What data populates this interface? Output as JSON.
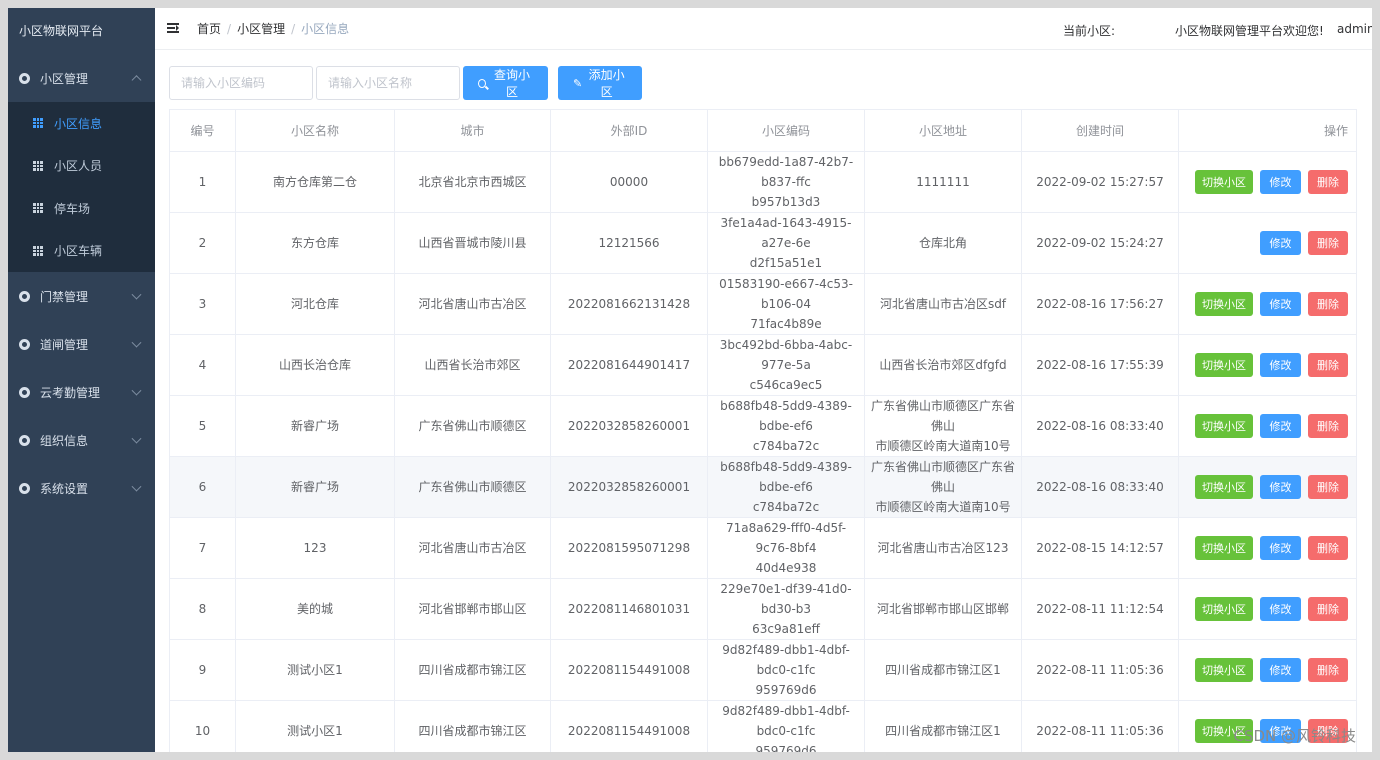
{
  "brand": "小区物联网平台",
  "sidebar": {
    "groups": [
      {
        "label": "小区管理",
        "expanded": true,
        "items": [
          {
            "label": "小区信息",
            "active": true
          },
          {
            "label": "小区人员"
          },
          {
            "label": "停车场"
          },
          {
            "label": "小区车辆"
          }
        ]
      },
      {
        "label": "门禁管理"
      },
      {
        "label": "道闸管理"
      },
      {
        "label": "云考勤管理"
      },
      {
        "label": "组织信息"
      },
      {
        "label": "系统设置"
      }
    ]
  },
  "navbar": {
    "breadcrumb": [
      "首页",
      "小区管理",
      "小区信息"
    ],
    "separator": "/",
    "current_community_label": "当前小区:",
    "welcome": "小区物联网管理平台欢迎您!",
    "user": "admin"
  },
  "search": {
    "code_placeholder": "请输入小区编码",
    "name_placeholder": "请输入小区名称",
    "query_label": "查询小区",
    "add_label": "添加小区"
  },
  "table": {
    "headers": [
      "编号",
      "小区名称",
      "城市",
      "外部ID",
      "小区编码",
      "小区地址",
      "创建时间",
      "操作"
    ],
    "actions": {
      "switch": "切换小区",
      "edit": "修改",
      "delete": "删除"
    },
    "rows": [
      {
        "no": "1",
        "name": "南方仓库第二仓",
        "city": "北京省北京市西城区",
        "ext": "00000",
        "code1": "bb679edd-1a87-42b7-b837-ffc",
        "code2": "b957b13d3",
        "addr1": "1111111",
        "addr2": "",
        "time": "2022-09-02 15:27:57",
        "switch": true
      },
      {
        "no": "2",
        "name": "东方仓库",
        "city": "山西省晋城市陵川县",
        "ext": "12121566",
        "code1": "3fe1a4ad-1643-4915-a27e-6e",
        "code2": "d2f15a51e1",
        "addr1": "仓库北角",
        "addr2": "",
        "time": "2022-09-02 15:24:27",
        "switch": false
      },
      {
        "no": "3",
        "name": "河北仓库",
        "city": "河北省唐山市古冶区",
        "ext": "2022081662131428",
        "code1": "01583190-e667-4c53-b106-04",
        "code2": "71fac4b89e",
        "addr1": "河北省唐山市古冶区sdf",
        "addr2": "",
        "time": "2022-08-16 17:56:27",
        "switch": true
      },
      {
        "no": "4",
        "name": "山西长治仓库",
        "city": "山西省长治市郊区",
        "ext": "2022081644901417",
        "code1": "3bc492bd-6bba-4abc-977e-5a",
        "code2": "c546ca9ec5",
        "addr1": "山西省长治市郊区dfgfd",
        "addr2": "",
        "time": "2022-08-16 17:55:39",
        "switch": true
      },
      {
        "no": "5",
        "name": "新睿广场",
        "city": "广东省佛山市顺德区",
        "ext": "2022032858260001",
        "code1": "b688fb48-5dd9-4389-bdbe-ef6",
        "code2": "c784ba72c",
        "addr1": "广东省佛山市顺德区广东省佛山",
        "addr2": "市顺德区岭南大道南10号",
        "time": "2022-08-16 08:33:40",
        "switch": true
      },
      {
        "no": "6",
        "name": "新睿广场",
        "city": "广东省佛山市顺德区",
        "ext": "2022032858260001",
        "code1": "b688fb48-5dd9-4389-bdbe-ef6",
        "code2": "c784ba72c",
        "addr1": "广东省佛山市顺德区广东省佛山",
        "addr2": "市顺德区岭南大道南10号",
        "time": "2022-08-16 08:33:40",
        "switch": true,
        "hover": true
      },
      {
        "no": "7",
        "name": "123",
        "city": "河北省唐山市古冶区",
        "ext": "2022081595071298",
        "code1": "71a8a629-fff0-4d5f-9c76-8bf4",
        "code2": "40d4e938",
        "addr1": "河北省唐山市古冶区123",
        "addr2": "",
        "time": "2022-08-15 14:12:57",
        "switch": true
      },
      {
        "no": "8",
        "name": "美的城",
        "city": "河北省邯郸市邯山区",
        "ext": "2022081146801031",
        "code1": "229e70e1-df39-41d0-bd30-b3",
        "code2": "63c9a81eff",
        "addr1": "河北省邯郸市邯山区邯郸",
        "addr2": "",
        "time": "2022-08-11 11:12:54",
        "switch": true
      },
      {
        "no": "9",
        "name": "测试小区1",
        "city": "四川省成都市锦江区",
        "ext": "2022081154491008",
        "code1": "9d82f489-dbb1-4dbf-bdc0-c1fc",
        "code2": "959769d6",
        "addr1": "四川省成都市锦江区1",
        "addr2": "",
        "time": "2022-08-11 11:05:36",
        "switch": true
      },
      {
        "no": "10",
        "name": "测试小区1",
        "city": "四川省成都市锦江区",
        "ext": "2022081154491008",
        "code1": "9d82f489-dbb1-4dbf-bdc0-c1fc",
        "code2": "959769d6",
        "addr1": "四川省成都市锦江区1",
        "addr2": "",
        "time": "2022-08-11 11:05:36",
        "switch": true
      }
    ]
  },
  "watermark": "CSDN @风铃科技"
}
